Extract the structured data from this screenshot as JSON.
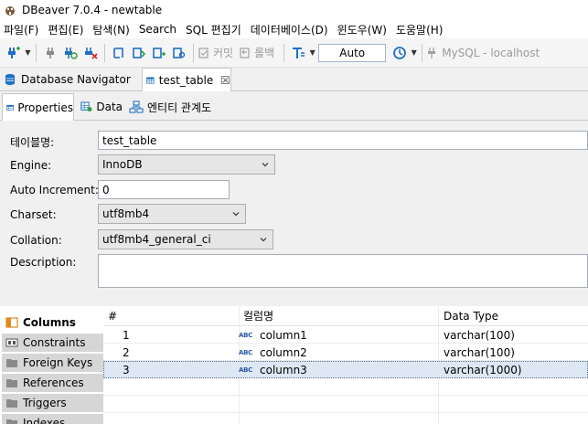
{
  "window": {
    "title": "DBeaver 7.0.4 - newtable"
  },
  "menu": {
    "items": [
      "파일(F)",
      "편집(E)",
      "탐색(N)",
      "Search",
      "SQL 편집기",
      "데이터베이스(D)",
      "윈도우(W)",
      "도움말(H)"
    ]
  },
  "toolbar": {
    "commit_label": "커밋",
    "rollback_label": "롤백",
    "transaction_mode": "Auto",
    "datasource": "MySQL - localhost"
  },
  "editor_tabs": {
    "navigator_label": "Database Navigator",
    "table_tab_label": "test_table",
    "close_glyph": "☒"
  },
  "sub_tabs": {
    "properties": "Properties",
    "data": "Data",
    "er_diagram": "엔티티 관계도"
  },
  "form": {
    "table_name_label": "테이블명:",
    "table_name_value": "test_table",
    "engine_label": "Engine:",
    "engine_value": "InnoDB",
    "auto_increment_label": "Auto Increment:",
    "auto_increment_value": "0",
    "charset_label": "Charset:",
    "charset_value": "utf8mb4",
    "collation_label": "Collation:",
    "collation_value": "utf8mb4_general_ci",
    "description_label": "Description:",
    "description_value": ""
  },
  "side_tabs": [
    "Columns",
    "Constraints",
    "Foreign Keys",
    "References",
    "Triggers",
    "Indexes"
  ],
  "columns_grid": {
    "headers": [
      "#",
      "컬럼명",
      "Data Type"
    ],
    "type_badge": "ABC",
    "rows": [
      {
        "num": "1",
        "name": "column1",
        "type": "varchar(100)"
      },
      {
        "num": "2",
        "name": "column2",
        "type": "varchar(100)"
      },
      {
        "num": "3",
        "name": "column3",
        "type": "varchar(1000)"
      }
    ]
  },
  "colors": {
    "accent_blue": "#1f6fc5",
    "selected_row": "#dde8f4",
    "side_tab_bg": "#d6d6d6"
  }
}
